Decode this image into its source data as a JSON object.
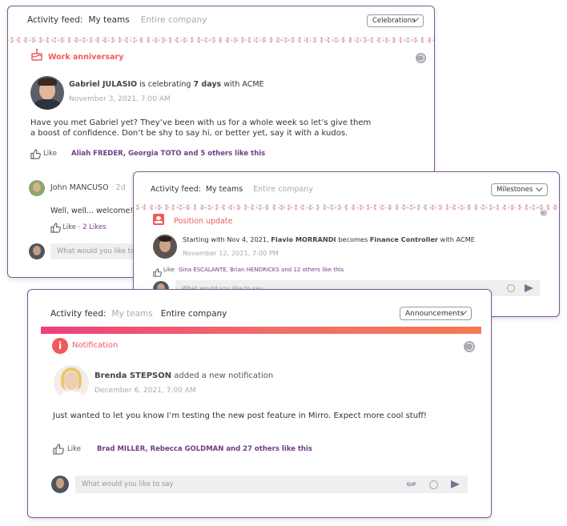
{
  "colors": {
    "accent": "#f0595a",
    "brand_purple": "#6e3d85",
    "card_border": "#7b5a8e"
  },
  "card1": {
    "feed_label": "Activity feed:",
    "tabs": [
      "My teams",
      "Entire company"
    ],
    "active_tab": 0,
    "filter": "Celebrations",
    "category": "Work anniversary",
    "category_icon": "cake-icon",
    "author": "Gabriel JULASIO",
    "action_prefix": "is celebrating",
    "action_bold": "7 days",
    "action_suffix": "with ACME",
    "date": "November 3, 2021, 7:00 AM",
    "body_line1": "Have you met Gabriel yet? They’ve been with us for a whole week so let’s give them",
    "body_line2": "a boost of confidence. Don’t be shy to say hi, or better yet, say it with a kudos.",
    "like_label": "Like",
    "likers": "Aliah FREDER, Georgia TOTO and 5 others like this",
    "comment": {
      "author": "John MANCUSO",
      "sep": "·",
      "time": "2d",
      "text": "Well, well... welcome!",
      "like_label": "Like",
      "dot": "·",
      "likes_count": "2 Likes"
    },
    "input_placeholder": "What would you like to say"
  },
  "card2": {
    "feed_label": "Activity feed:",
    "tabs": [
      "My teams",
      "Entire company"
    ],
    "active_tab": 0,
    "filter": "Milestones",
    "category": "Position update",
    "category_icon": "badge-icon",
    "text_prefix": "Starting with Nov 4, 2021,",
    "author": "Flavio MORRANDI",
    "text_mid": "becomes",
    "role": "Finance Controller",
    "text_suffix": "with ACME",
    "date": "November 12, 2021, 7:00 PM",
    "like_label": "Like",
    "likers": "Gina ESCALANTE, Brian HENDRICKS and 12 others like this",
    "input_placeholder": "What would you like to say"
  },
  "card3": {
    "feed_label": "Activity feed:",
    "tabs": [
      "My teams",
      "Entire company"
    ],
    "active_tab": 1,
    "filter": "Announcements",
    "category": "Notification",
    "category_icon": "info-icon",
    "author": "Brenda STEPSON",
    "action": "added a new notification",
    "date": "December 6, 2021, 7:00 AM",
    "body": "Just wanted to let you know I’m testing the new post feature in Mirro. Expect more cool stuff!",
    "like_label": "Like",
    "likers": "Brad MILLER, Rebecca GOLDMAN and 27 others like this",
    "input_placeholder": "What would you like to say",
    "gif_label": "GIF"
  }
}
